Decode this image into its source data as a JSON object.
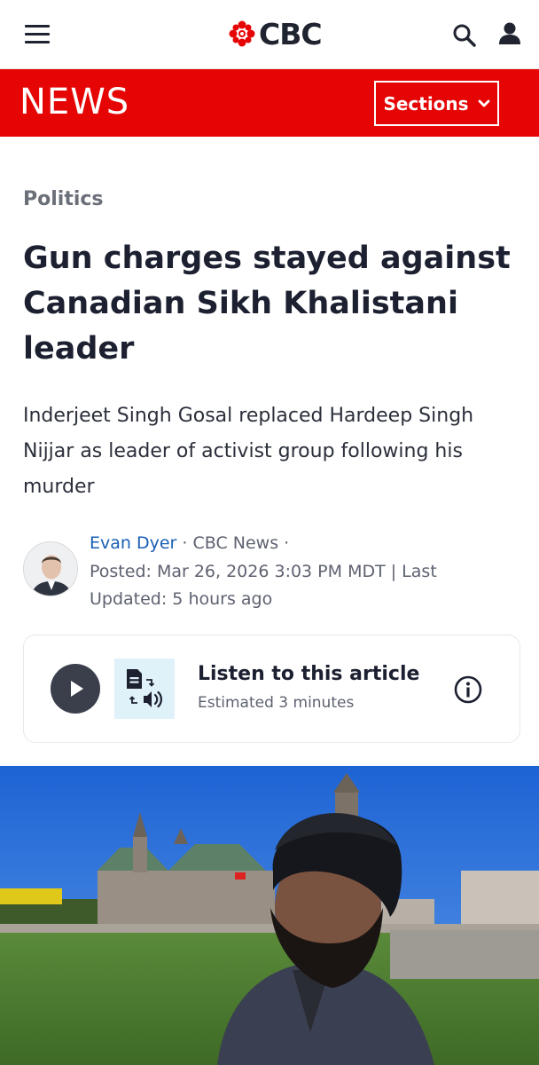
{
  "header": {
    "logo_text": "CBC",
    "menu_icon": "hamburger-menu-icon",
    "search_icon": "search-icon",
    "account_icon": "account-icon",
    "brand_color": "#e60505"
  },
  "newsbar": {
    "label": "NEWS",
    "sections_label": "Sections"
  },
  "article": {
    "category": "Politics",
    "headline_lines": [
      "Gun charges stayed against",
      "Canadian Sikh Khalistani",
      "leader"
    ],
    "dek_lines": [
      "Inderjeet Singh Gosal replaced Hardeep Singh",
      "Nijjar as leader of activist group following his",
      "murder"
    ]
  },
  "byline": {
    "author": "Evan Dyer",
    "outlet_suffix": " · CBC News ·",
    "line2": "Posted: Mar 26, 2026 3:03 PM MDT | Last",
    "line3": "Updated: 5 hours ago"
  },
  "listen": {
    "title": "Listen to this article",
    "subtitle": "Estimated 3 minutes",
    "play_icon": "play-icon",
    "tts_icon": "text-to-speech-icon",
    "info_icon": "info-icon"
  }
}
